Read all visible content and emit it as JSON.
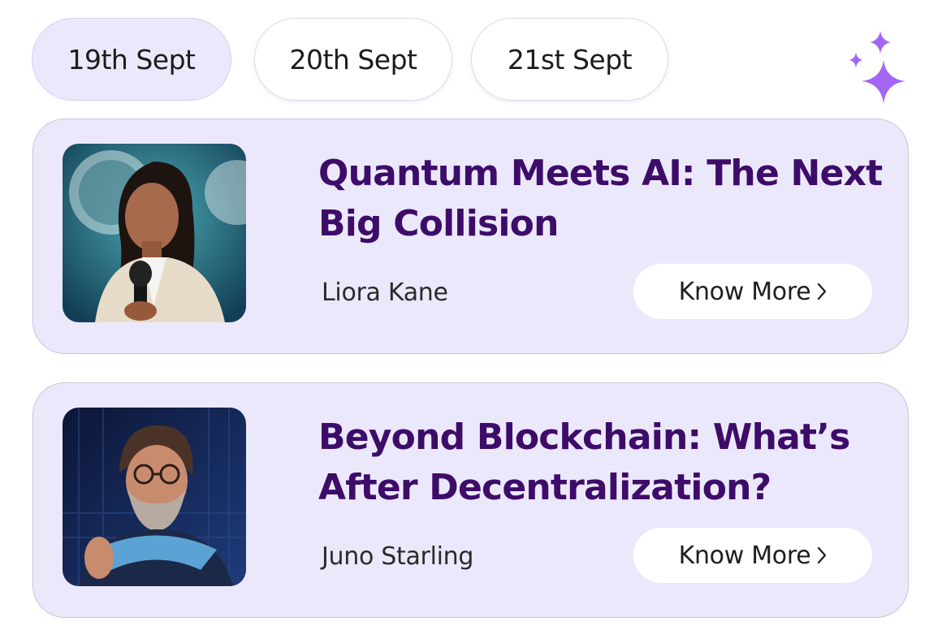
{
  "date_tabs": [
    {
      "label": "19th Sept",
      "active": true
    },
    {
      "label": "20th Sept",
      "active": false
    },
    {
      "label": "21st Sept",
      "active": false
    }
  ],
  "sparkle_icon": "sparkles-icon",
  "colors": {
    "accent": "#3d0c69",
    "card_background": "#ece8fb",
    "sparkle": "#a366f2"
  },
  "sessions": [
    {
      "title": "Quantum Meets AI: The Next Big Collision",
      "speaker": "Liora Kane",
      "button_label": "Know More",
      "photo_icon": "speaker-photo"
    },
    {
      "title": "Beyond Blockchain: What’s After Decentralization?",
      "speaker": "Juno Starling",
      "button_label": "Know More",
      "photo_icon": "speaker-photo"
    }
  ]
}
